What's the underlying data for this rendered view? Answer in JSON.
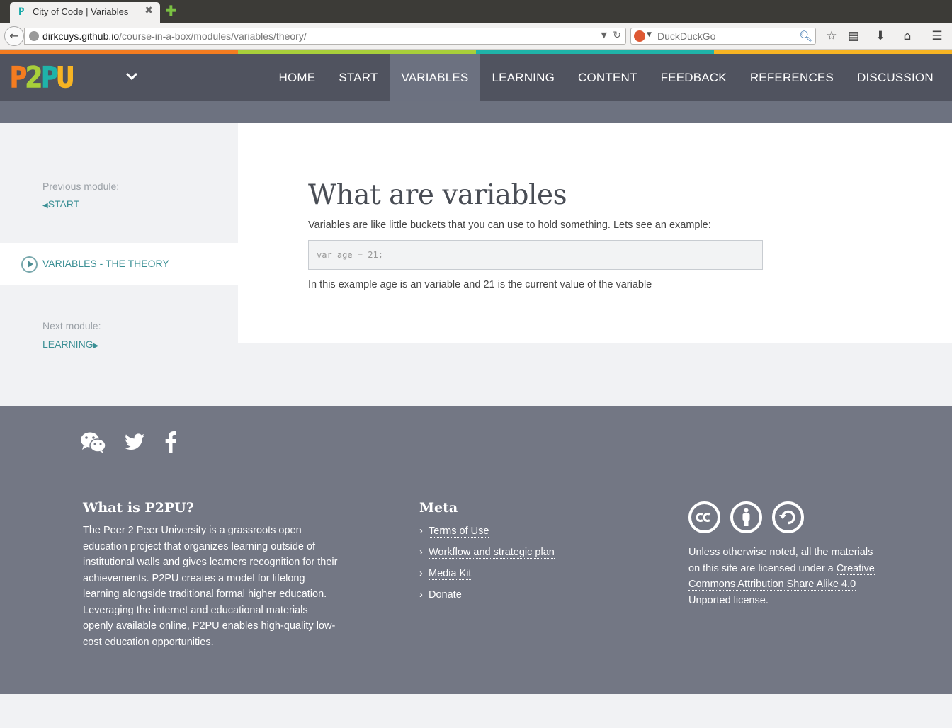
{
  "browser": {
    "tab_title": "City of Code | Variables",
    "tab_favicon": "P",
    "url_host": "dirkcuys.github.io",
    "url_path": "/course-in-a-box/modules/variables/theory/",
    "search_placeholder": "DuckDuckGo"
  },
  "stripe_colors": [
    "#f47c20",
    "#a8cf3a",
    "#1fb3a9",
    "#f7b423"
  ],
  "site": {
    "logo_letters": [
      "P",
      "2",
      "P",
      "U"
    ],
    "logo_colors": [
      "#f47c20",
      "#a8cf3a",
      "#1fb3a9",
      "#f7b423"
    ],
    "nav": [
      {
        "label": "HOME",
        "active": false
      },
      {
        "label": "START",
        "active": false
      },
      {
        "label": "VARIABLES",
        "active": true
      },
      {
        "label": "LEARNING",
        "active": false
      },
      {
        "label": "CONTENT",
        "active": false
      },
      {
        "label": "FEEDBACK",
        "active": false
      },
      {
        "label": "REFERENCES",
        "active": false
      },
      {
        "label": "DISCUSSION",
        "active": false
      }
    ]
  },
  "sidebar": {
    "previous_label": "Previous module:",
    "previous_link": "START",
    "current": "VARIABLES - THE THEORY",
    "next_label": "Next module:",
    "next_link": "LEARNING"
  },
  "main": {
    "title": "What are variables",
    "intro": "Variables are like little buckets that you can use to hold something. Lets see an example:",
    "code": "var age = 21;",
    "explanation": "In this example age is an variable and 21 is the current value of the variable"
  },
  "footer": {
    "social_icons": [
      "wechat-icon",
      "twitter-icon",
      "facebook-icon"
    ],
    "about_heading": "What is P2PU?",
    "about_text": "The Peer 2 Peer University is a grassroots open education project that organizes learning outside of institutional walls and gives learners recognition for their achievements. P2PU creates a model for lifelong learning alongside traditional formal higher education. Leveraging the internet and educational materials openly available online, P2PU enables high-quality low-cost education opportunities.",
    "meta_heading": "Meta",
    "meta_links": [
      "Terms of Use",
      "Workflow and strategic plan",
      "Media Kit",
      "Donate"
    ],
    "license_prefix": "Unless otherwise noted, all the materials on this site are licensed under a ",
    "license_link": "Creative Commons Attribution Share Alike 4.0",
    "license_suffix": " Unported license."
  }
}
